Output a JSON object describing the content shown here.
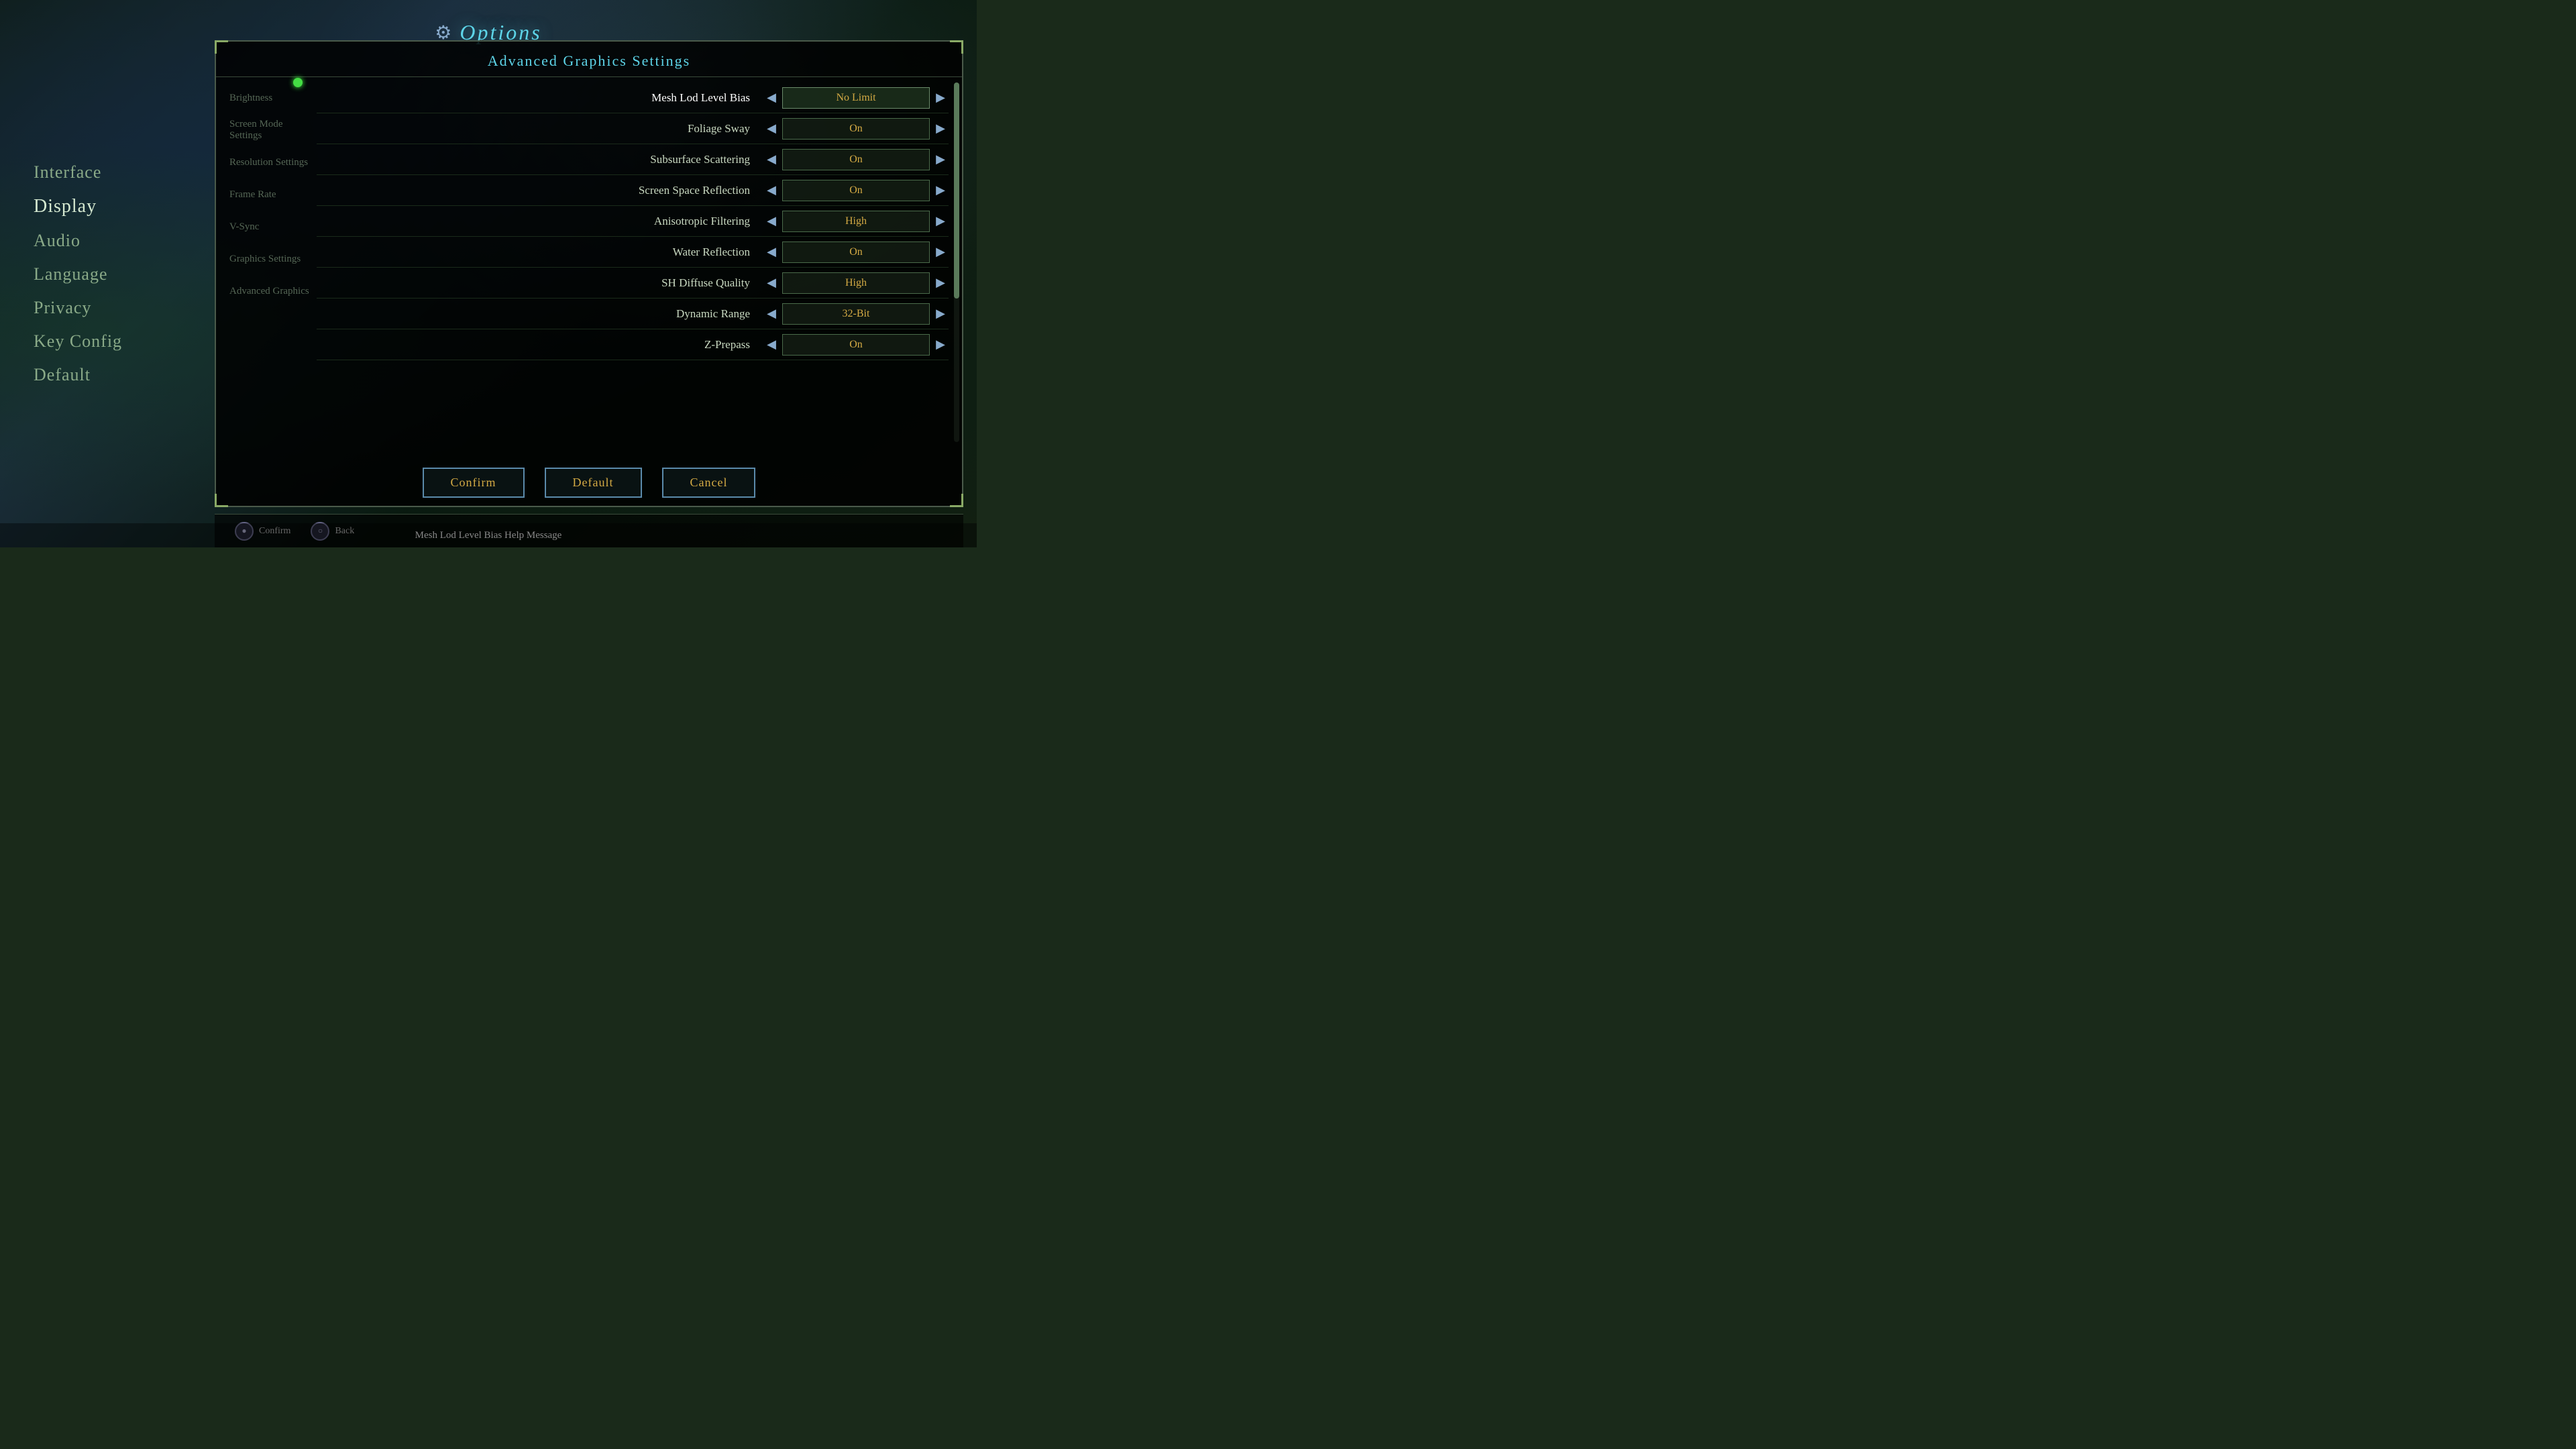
{
  "title": {
    "gear_icon": "⚙",
    "text": "Options"
  },
  "sidebar": {
    "items": [
      {
        "id": "interface",
        "label": "Interface",
        "active": false
      },
      {
        "id": "display",
        "label": "Display",
        "active": true
      },
      {
        "id": "audio",
        "label": "Audio",
        "active": false
      },
      {
        "id": "language",
        "label": "Language",
        "active": false
      },
      {
        "id": "privacy",
        "label": "Privacy",
        "active": false
      },
      {
        "id": "key-config",
        "label": "Key Config",
        "active": false
      },
      {
        "id": "default",
        "label": "Default",
        "active": false
      }
    ]
  },
  "panel": {
    "title": "Advanced Graphics Settings",
    "sidebar_labels": [
      {
        "label": "Brightness"
      },
      {
        "label": "Screen Mode Settings"
      },
      {
        "label": "Resolution Settings"
      },
      {
        "label": "Frame Rate"
      },
      {
        "label": "V-Sync"
      },
      {
        "label": "Graphics Settings"
      },
      {
        "label": "Advanced Graphics"
      }
    ],
    "settings": [
      {
        "label": "Mesh Lod Level Bias",
        "value": "No Limit",
        "active": true
      },
      {
        "label": "Foliage Sway",
        "value": "On"
      },
      {
        "label": "Subsurface Scattering",
        "value": "On"
      },
      {
        "label": "Screen Space Reflection",
        "value": "On"
      },
      {
        "label": "Anisotropic Filtering",
        "value": "High"
      },
      {
        "label": "Water Reflection",
        "value": "On"
      },
      {
        "label": "SH Diffuse Quality",
        "value": "High"
      },
      {
        "label": "Dynamic Range",
        "value": "32-Bit"
      },
      {
        "label": "Z-Prepass",
        "value": "On"
      }
    ],
    "buttons": [
      {
        "id": "confirm",
        "label": "Confirm"
      },
      {
        "id": "default",
        "label": "Default"
      },
      {
        "id": "cancel",
        "label": "Cancel"
      }
    ]
  },
  "bottom_controls": [
    {
      "icon": "●",
      "label": "Confirm"
    },
    {
      "icon": "○",
      "label": "Back"
    }
  ],
  "help_text": "Mesh Lod Level Bias Help Message",
  "icons": {
    "arrow_left": "◀",
    "arrow_right": "▶"
  }
}
